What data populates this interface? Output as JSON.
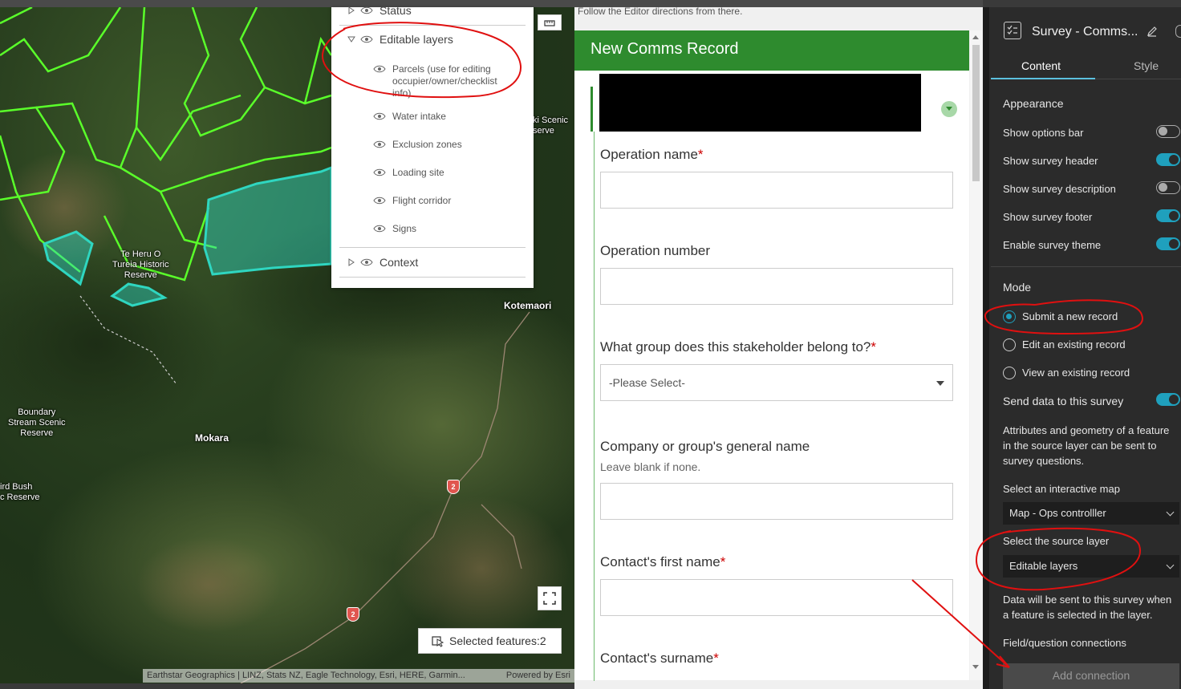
{
  "map": {
    "labels": {
      "te_heru": "Te Heru O\nTureia Historic\nReserve",
      "kotemaori": "Kotemaori",
      "boundary": "Boundary\nStream Scenic\nReserve",
      "mokara": "Mokara",
      "bush": "ird Bush\nc Reserve",
      "scenic": "ki Scenic\nserve"
    },
    "road_number": "2",
    "selected_features": "Selected features:2",
    "attribution_left": "Earthstar Geographics | LINZ, Stats NZ, Eagle Technology, Esri, HERE, Garmin...",
    "attribution_right": "Powered by Esri"
  },
  "layer_list": {
    "status": "Status",
    "editable_layers": "Editable layers",
    "parcels": "Parcels (use for editing occupier/owner/checklist info)",
    "water_intake": "Water intake",
    "exclusion_zones": "Exclusion zones",
    "loading_site": "Loading site",
    "flight_corridor": "Flight corridor",
    "signs": "Signs",
    "context": "Context"
  },
  "form": {
    "instruction": "Follow the Editor directions from there.",
    "title": "New Comms Record",
    "q1": "Operation name",
    "q2": "Operation number",
    "q3": "What group does this stakeholder belong to?",
    "q3_placeholder": "-Please Select-",
    "q4": "Company or group's general name",
    "q4_hint": "Leave blank if none.",
    "q5": "Contact's first name",
    "q6": "Contact's surname",
    "required_mark": "*"
  },
  "settings": {
    "title": "Survey - Comms...",
    "tab_content": "Content",
    "tab_style": "Style",
    "appearance": "Appearance",
    "show_options_bar": "Show options bar",
    "show_survey_header": "Show survey header",
    "show_survey_description": "Show survey description",
    "show_survey_footer": "Show survey footer",
    "enable_survey_theme": "Enable survey theme",
    "toggles": {
      "options_bar": false,
      "survey_header": true,
      "survey_description": false,
      "survey_footer": true,
      "survey_theme": true,
      "send_data": true
    },
    "mode": "Mode",
    "submit_new": "Submit a new record",
    "edit_existing": "Edit an existing record",
    "view_existing": "View an existing record",
    "send_data": "Send data to this survey",
    "send_data_desc": "Attributes and geometry of a feature in the source layer can be sent to survey questions.",
    "select_map_label": "Select an interactive map",
    "select_map_value": "Map - Ops controlller",
    "select_layer_label": "Select the source layer",
    "select_layer_value": "Editable layers",
    "data_sent_desc": "Data will be sent to this survey when a feature is selected in the layer.",
    "field_connections": "Field/question connections",
    "add_connection": "Add connection"
  },
  "colors": {
    "form_header": "#2e8b2e",
    "accent": "#1fa0bd",
    "annotation": "#e01010",
    "parcel_outline": "#5aff2a",
    "selected_fill": "#2fd6c0"
  }
}
